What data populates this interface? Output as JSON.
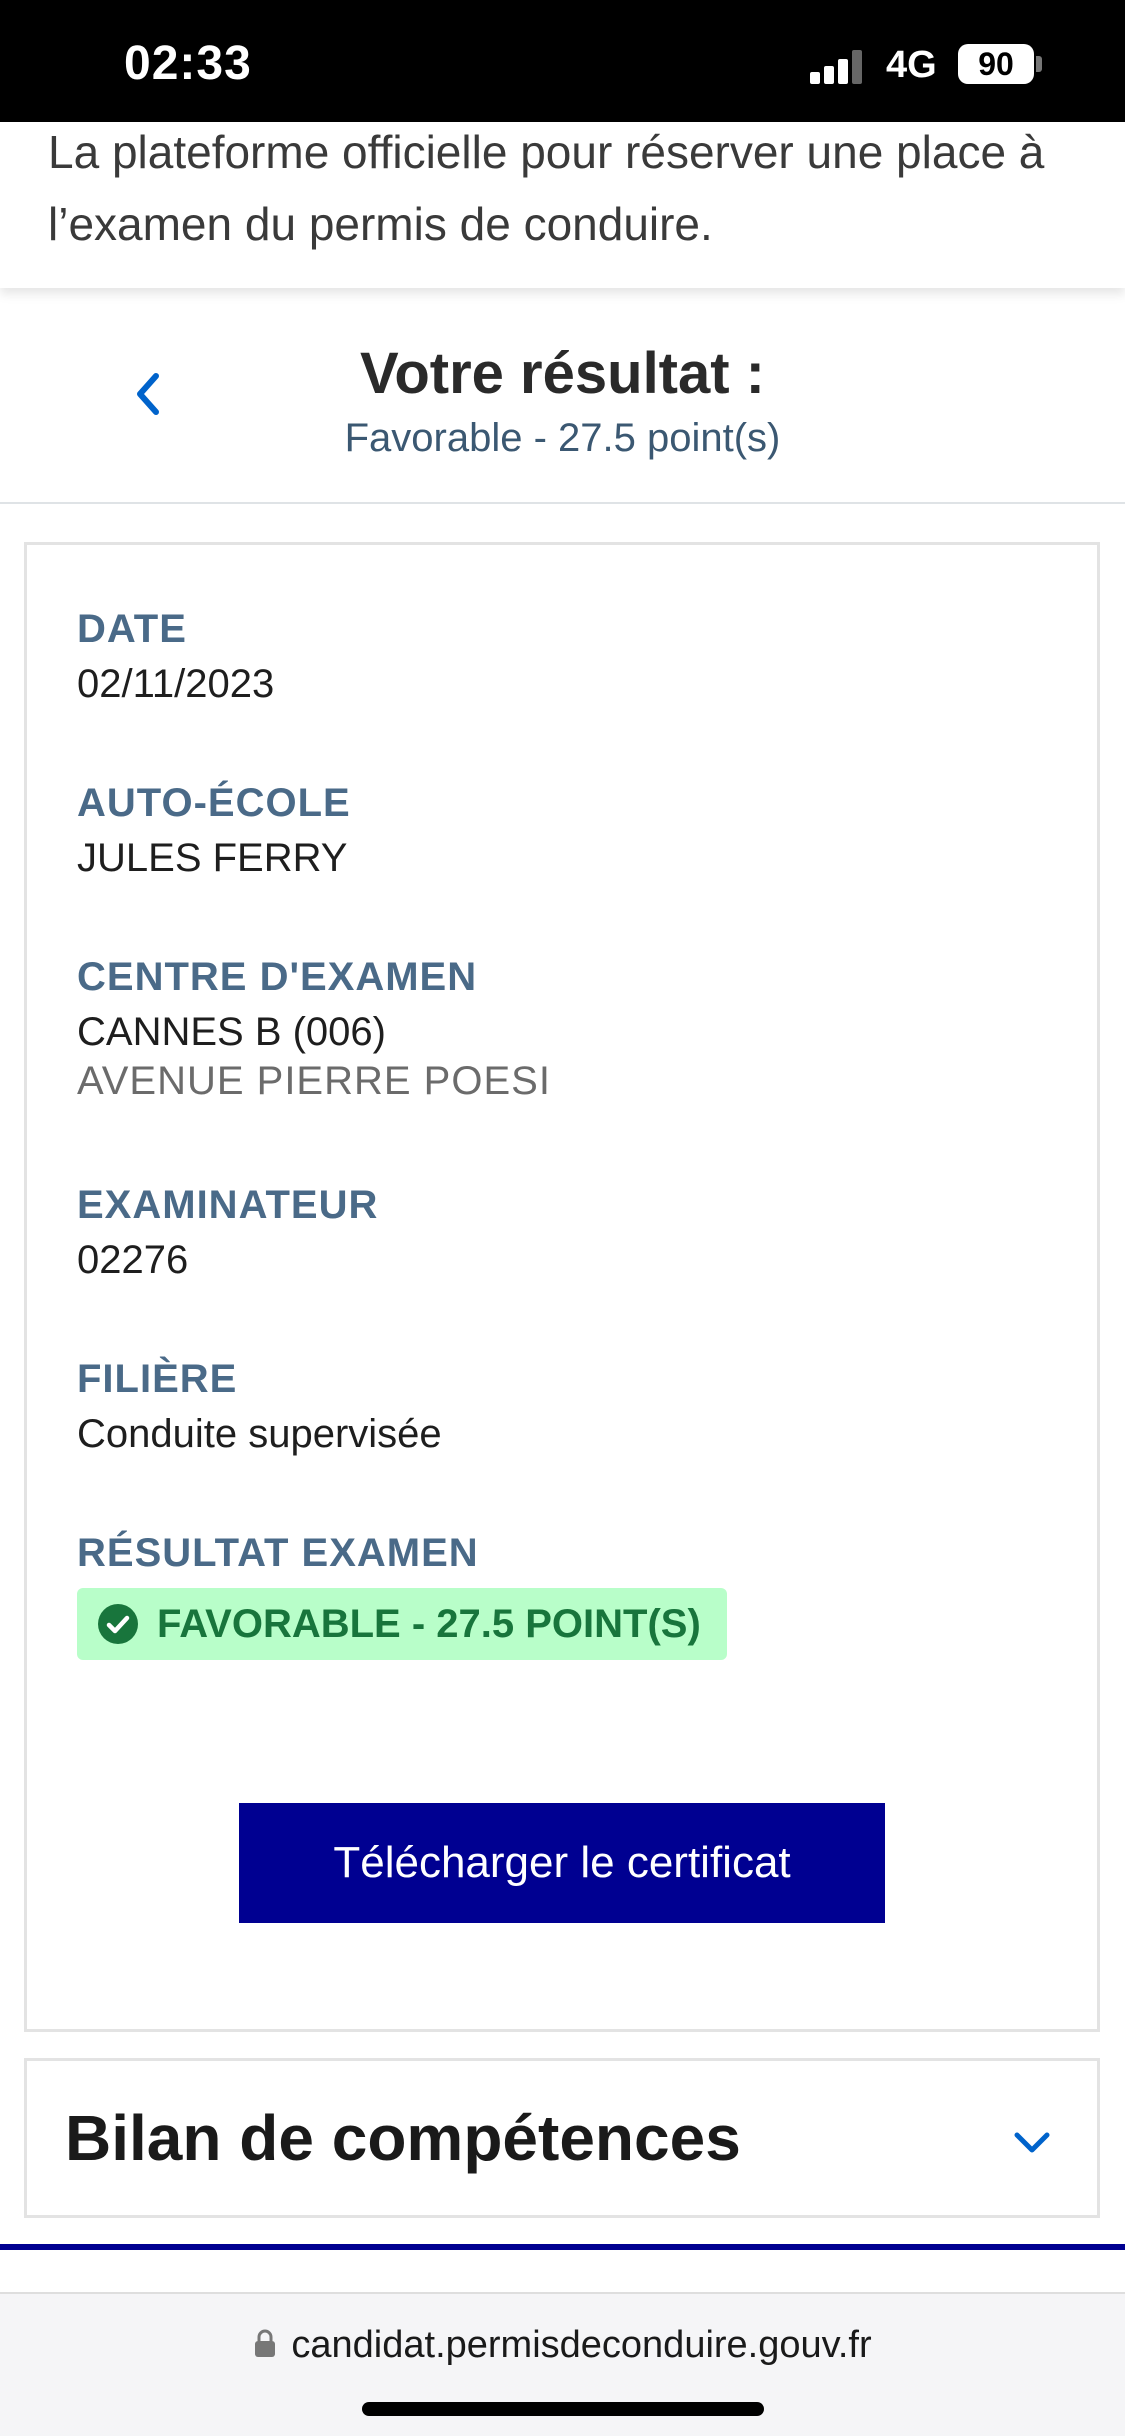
{
  "status_bar": {
    "time": "02:33",
    "network": "4G",
    "battery": "90"
  },
  "banner": {
    "text": "La plateforme officielle pour réserver une place à l’examen du permis de conduire."
  },
  "result_header": {
    "title": "Votre résultat :",
    "subtitle": "Favorable - 27.5 point(s)",
    "back_icon": "chevron-left-icon"
  },
  "details": {
    "date_label": "DATE",
    "date_value": "02/11/2023",
    "school_label": "AUTO-ÉCOLE",
    "school_value": "JULES FERRY",
    "center_label": "CENTRE D'EXAMEN",
    "center_value": "CANNES B (006)",
    "center_address": "AVENUE PIERRE POESI",
    "examiner_label": "EXAMINATEUR",
    "examiner_value": "02276",
    "track_label": "FILIÈRE",
    "track_value": "Conduite supervisée",
    "result_label": "RÉSULTAT EXAMEN",
    "result_badge": "FAVORABLE - 27.5 POINT(S)"
  },
  "download_button": "Télécharger le certificat",
  "accordion": {
    "title": "Bilan de compétences"
  },
  "browser": {
    "url": "candidat.permisdeconduire.gouv.fr"
  },
  "colors": {
    "primary": "#000091",
    "label": "#4a6a88",
    "success_bg": "#b8fec9",
    "success_text": "#18753c"
  }
}
